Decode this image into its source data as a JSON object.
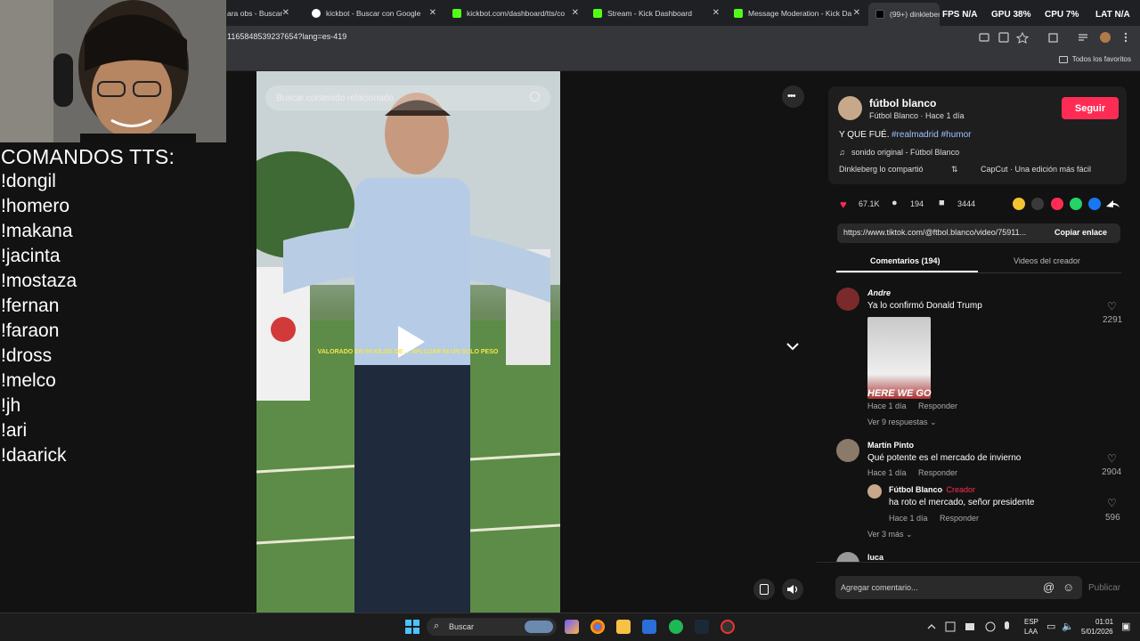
{
  "tabs": [
    {
      "label": "ara obs - Buscar"
    },
    {
      "label": "kickbot - Buscar con Google"
    },
    {
      "label": "kickbot.com/dashboard/tts/co"
    },
    {
      "label": "Stream - Kick Dashboard"
    },
    {
      "label": "Message Moderation - Kick Da"
    },
    {
      "label": "(99+) dinkleberg (@ ..."
    }
  ],
  "hud": {
    "fps": "FPS",
    "fps_val": "N/A",
    "gpu": "GPU",
    "gpu_val": "38%",
    "cpu": "CPU",
    "cpu_val": "7%",
    "lat": "LAT",
    "lat_val": "N/A"
  },
  "address": {
    "url": "1165848539237654?lang=es-419"
  },
  "bookmarks": {
    "all_label": "Todos los favoritos"
  },
  "tts": {
    "title": "COMANDOS TTS:",
    "commands": [
      "!dongil",
      "!homero",
      "!makana",
      "!jacinta",
      "!mostaza",
      "!fernan",
      "!faraon",
      "!dross",
      "!melco",
      "!jh",
      "!ari",
      "!daarick"
    ]
  },
  "video": {
    "search_placeholder": "Buscar contenido relacionado",
    "caption": "VALORADO EN 50 KILOS DE ... AFLOJAR NI UN SOLO PESO"
  },
  "post": {
    "author_name": "fútbol blanco",
    "author_sub": "Fútbol Blanco · Hace 1 día",
    "follow_label": "Seguir",
    "description": "Y QUE FUÉ.",
    "hashtags": "#realmadrid #humor",
    "sound": "sonido original - Fútbol Blanco",
    "shared_by": "Dinkleberg lo compartió",
    "capcut": "CapCut · Una edición más fácil",
    "likes": "67.1K",
    "comments": "194",
    "saves": "3444",
    "link": "https://www.tiktok.com/@ftbol.blanco/video/75911...",
    "copy_label": "Copiar enlace",
    "tab_comments": "Comentarios (194)",
    "tab_creator": "Videos del creador"
  },
  "comments": [
    {
      "user": "Andre",
      "text": "Ya lo confirmó Donald Trump",
      "meta": "Hace 1 día",
      "reply": "Responder",
      "likes": "2291",
      "replies_label": "Ver 9 respuestas",
      "image_text": "HERE WE GO"
    },
    {
      "user": "Martín Pinto",
      "text": "Qué potente es el mercado de invierno",
      "meta": "Hace 1 día",
      "reply": "Responder",
      "likes": "2904"
    },
    {
      "user": "Fútbol Blanco",
      "creator_tag": "Creador",
      "text": "ha roto el mercado, señor presidente",
      "meta": "Hace 1 día",
      "reply": "Responder",
      "likes": "596",
      "more_label": "Ver 3 más"
    },
    {
      "user": "luca"
    }
  ],
  "composer": {
    "placeholder": "Agregar comentario...",
    "publish": "Publicar"
  },
  "taskbar": {
    "search": "Buscar",
    "lang1": "ESP",
    "lang2": "LAA",
    "time": "01:01",
    "date": "5/01/2026"
  }
}
